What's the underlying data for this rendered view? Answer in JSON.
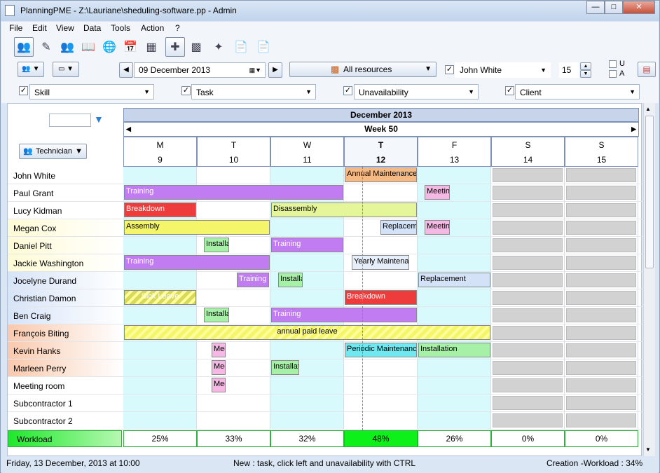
{
  "window": {
    "title": "PlanningPME - Z:\\Lauriane\\sheduling-software.pp - Admin"
  },
  "menu": [
    "File",
    "Edit",
    "View",
    "Data",
    "Tools",
    "Action",
    "?"
  ],
  "toolbar": {
    "date": "09 December 2013",
    "resources": "All resources",
    "person": "John White",
    "zoom": "15",
    "opt_u": "U",
    "opt_a": "A"
  },
  "filters": {
    "skill": "Skill",
    "task": "Task",
    "unavailability": "Unavailability",
    "client": "Client"
  },
  "grid": {
    "month": "December 2013",
    "week": "Week 50",
    "resource_button": "Technician",
    "days": [
      {
        "l": "M",
        "n": "9"
      },
      {
        "l": "T",
        "n": "10"
      },
      {
        "l": "W",
        "n": "11"
      },
      {
        "l": "T",
        "n": "12"
      },
      {
        "l": "F",
        "n": "13"
      },
      {
        "l": "S",
        "n": "14"
      },
      {
        "l": "S",
        "n": "15"
      }
    ],
    "resources": [
      "John White",
      "Paul Grant",
      "Lucy Kidman",
      "Megan Cox",
      "Daniel Pitt",
      "Jackie Washington",
      "Jocelyne Durand",
      "Christian Damon",
      "Ben Craig",
      "François Biting",
      "Kevin Hanks",
      "Marleen Perry",
      "Meeting room",
      "Subcontractor 1",
      "Subcontractor 2"
    ],
    "workload_label": "Workload",
    "workload": [
      "25%",
      "33%",
      "32%",
      "48%",
      "26%",
      "0%",
      "0%"
    ]
  },
  "tasks": [
    {
      "row": 0,
      "label": "Annual Maintenance",
      "color": "#f5b984"
    },
    {
      "row": 1,
      "label": "Training",
      "color": "#c07cf0"
    },
    {
      "row": 1,
      "label": "Meeting",
      "color": "#f5b8e4"
    },
    {
      "row": 2,
      "label": "Breakdown",
      "color": "#ee3b3b"
    },
    {
      "row": 2,
      "label": "Disassembly",
      "color": "#e4f59a"
    },
    {
      "row": 3,
      "label": "Assembly",
      "color": "#f5f56a"
    },
    {
      "row": 3,
      "label": "Replacement",
      "color": "#d4e2f7"
    },
    {
      "row": 3,
      "label": "Meeting",
      "color": "#f5b8e4"
    },
    {
      "row": 4,
      "label": "Installation",
      "color": "#a7f0a7"
    },
    {
      "row": 4,
      "label": "Training",
      "color": "#c07cf0"
    },
    {
      "row": 5,
      "label": "Training",
      "color": "#c07cf0"
    },
    {
      "row": 5,
      "label": "Yearly Maintenance",
      "color": "#e6eef9"
    },
    {
      "row": 6,
      "label": "Training",
      "color": "#c07cf0"
    },
    {
      "row": 6,
      "label": "Installation",
      "color": "#a7f0a7"
    },
    {
      "row": 6,
      "label": "Replacement",
      "color": "#d4e2f7"
    },
    {
      "row": 7,
      "label": "Sick Leave",
      "color": "#d8d85a"
    },
    {
      "row": 7,
      "label": "Breakdown",
      "color": "#ee3b3b"
    },
    {
      "row": 8,
      "label": "Installation",
      "color": "#a7f0a7"
    },
    {
      "row": 8,
      "label": "Training",
      "color": "#c07cf0"
    },
    {
      "row": 9,
      "label": "annual paid leave",
      "color": "#f5f56a"
    },
    {
      "row": 10,
      "label": "Meeting",
      "color": "#f5b8e4"
    },
    {
      "row": 10,
      "label": "Periodic Maintenance",
      "color": "#6fe8f0"
    },
    {
      "row": 10,
      "label": "Installation",
      "color": "#a7f0a7"
    },
    {
      "row": 11,
      "label": "Meeting",
      "color": "#f5b8e4"
    },
    {
      "row": 11,
      "label": "Installation",
      "color": "#a7f0a7"
    },
    {
      "row": 12,
      "label": "Meeting",
      "color": "#f5b8e4"
    }
  ],
  "status": {
    "left": "Friday, 13 December, 2013 at 10:00",
    "center": "New : task, click left and unavailability with CTRL",
    "right": "Creation -Workload : 34%"
  }
}
